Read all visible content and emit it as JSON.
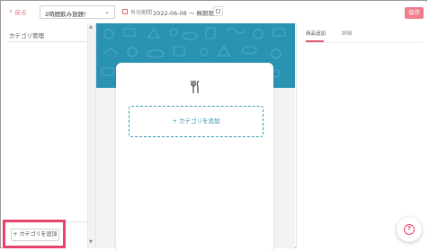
{
  "header": {
    "back_label": "戻る",
    "plan_selected": "2時間飲み放題！",
    "period_label": "有効期間",
    "period_value": "2022-06-08 〜 無期限",
    "save_label": "保存"
  },
  "left_panel": {
    "title": "カテゴリ管理",
    "add_button_label": "+ カテゴリを追加"
  },
  "center": {
    "add_category_label": "+ カテゴリを追加"
  },
  "right_panel": {
    "tabs": [
      {
        "label": "商品追加",
        "active": true
      },
      {
        "label": "詳細",
        "active": false
      }
    ]
  },
  "help": {
    "label": "?"
  },
  "colors": {
    "accent": "#e25a6e",
    "highlight": "#e8426a",
    "banner": "#2a93b4",
    "save_bg": "#f07c8e"
  },
  "icons": [
    "chevron-left-icon",
    "caret-down-icon",
    "calendar-icon",
    "cutlery-icon",
    "help-icon"
  ]
}
